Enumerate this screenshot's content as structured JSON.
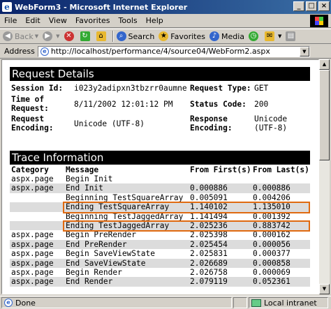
{
  "window": {
    "title": "WebForm3 - Microsoft Internet Explorer",
    "controls": [
      "_",
      "□",
      "×"
    ]
  },
  "menu": [
    "File",
    "Edit",
    "View",
    "Favorites",
    "Tools",
    "Help"
  ],
  "toolbar": {
    "back": "Back",
    "search": "Search",
    "favorites": "Favorites",
    "media": "Media"
  },
  "address": {
    "label": "Address",
    "url": "http://localhost/performance/4/source04/WebForm2.aspx"
  },
  "request": {
    "heading": "Request Details",
    "session_label": "Session Id:",
    "session_value": "i023y2adipxn3tbzrr0aumne",
    "time_label": "Time of Request:",
    "time_value": "8/11/2002 12:01:12 PM",
    "req_enc_label": "Request Encoding:",
    "req_enc_value": "Unicode (UTF-8)",
    "type_label": "Request Type:",
    "type_value": "GET",
    "status_label": "Status Code:",
    "status_value": "200",
    "resp_enc_label": "Response Encoding:",
    "resp_enc_value": "Unicode (UTF-8)"
  },
  "trace": {
    "heading": "Trace Information",
    "columns": [
      "Category",
      "Message",
      "From First(s)",
      "From Last(s)"
    ],
    "rows": [
      [
        "aspx.page",
        "Begin Init",
        "",
        ""
      ],
      [
        "aspx.page",
        "End Init",
        "0.000886",
        "0.000886"
      ],
      [
        "",
        "Beginning TestSquareArray",
        "0.005091",
        "0.004206"
      ],
      [
        "",
        "Ending TestSquareArray",
        "1.140102",
        "1.135010"
      ],
      [
        "",
        "Beginning TestJaggedArray",
        "1.141494",
        "0.001392"
      ],
      [
        "",
        "Ending TestJaggedArray",
        "2.025236",
        "0.883742"
      ],
      [
        "aspx.page",
        "Begin PreRender",
        "2.025398",
        "0.000162"
      ],
      [
        "aspx.page",
        "End PreRender",
        "2.025454",
        "0.000056"
      ],
      [
        "aspx.page",
        "Begin SaveViewState",
        "2.025831",
        "0.000377"
      ],
      [
        "aspx.page",
        "End SaveViewState",
        "2.026689",
        "0.000858"
      ],
      [
        "aspx.page",
        "Begin Render",
        "2.026758",
        "0.000069"
      ],
      [
        "aspx.page",
        "End Render",
        "2.079119",
        "0.052361"
      ]
    ],
    "highlight_color": "#e06a10"
  },
  "status": {
    "text": "Done",
    "zone": "Local intranet"
  }
}
